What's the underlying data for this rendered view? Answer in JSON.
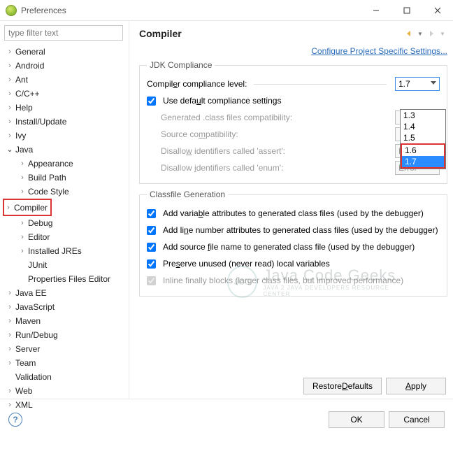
{
  "window": {
    "title": "Preferences"
  },
  "filter": {
    "placeholder": "type filter text"
  },
  "tree": {
    "items": [
      {
        "label": "General",
        "expandable": true
      },
      {
        "label": "Android",
        "expandable": true
      },
      {
        "label": "Ant",
        "expandable": true
      },
      {
        "label": "C/C++",
        "expandable": true
      },
      {
        "label": "Help",
        "expandable": true
      },
      {
        "label": "Install/Update",
        "expandable": true
      },
      {
        "label": "Ivy",
        "expandable": true
      },
      {
        "label": "Java",
        "expandable": true,
        "expanded": true,
        "children": [
          {
            "label": "Appearance",
            "expandable": true
          },
          {
            "label": "Build Path",
            "expandable": true
          },
          {
            "label": "Code Style",
            "expandable": true
          },
          {
            "label": "Compiler",
            "expandable": true,
            "selected": true
          },
          {
            "label": "Debug",
            "expandable": true
          },
          {
            "label": "Editor",
            "expandable": true
          },
          {
            "label": "Installed JREs",
            "expandable": true
          },
          {
            "label": "JUnit",
            "expandable": false
          },
          {
            "label": "Properties Files Editor",
            "expandable": false
          }
        ]
      },
      {
        "label": "Java EE",
        "expandable": true
      },
      {
        "label": "JavaScript",
        "expandable": true
      },
      {
        "label": "Maven",
        "expandable": true
      },
      {
        "label": "Run/Debug",
        "expandable": true
      },
      {
        "label": "Server",
        "expandable": true
      },
      {
        "label": "Team",
        "expandable": true
      },
      {
        "label": "Validation",
        "expandable": false
      },
      {
        "label": "Web",
        "expandable": true
      },
      {
        "label": "XML",
        "expandable": true
      }
    ]
  },
  "page": {
    "title": "Compiler",
    "configure_link": "Configure Project Specific Settings...",
    "jdk": {
      "legend": "JDK Compliance",
      "compliance_label": "Compiler compliance level:",
      "compliance_value": "1.7",
      "compliance_options": [
        "1.3",
        "1.4",
        "1.5",
        "1.6",
        "1.7"
      ],
      "use_default_label": "Use default compliance settings",
      "use_default_checked": true,
      "generated_label": "Generated .class files compatibility:",
      "generated_value": "",
      "source_label": "Source compatibility:",
      "source_value": "",
      "assert_label": "Disallow identifiers called 'assert':",
      "assert_value": "Error",
      "enum_label": "Disallow identifiers called 'enum':",
      "enum_value": "Error"
    },
    "classfile": {
      "legend": "Classfile Generation",
      "add_var_label": "Add variable attributes to generated class files (used by the debugger)",
      "add_var_checked": true,
      "add_line_label": "Add line number attributes to generated class files (used by the debugger)",
      "add_line_checked": true,
      "add_source_label": "Add source file name to generated class file (used by the debugger)",
      "add_source_checked": true,
      "preserve_label": "Preserve unused (never read) local variables",
      "preserve_checked": true,
      "inline_label": "Inline finally blocks (larger class files, but improved performance)",
      "inline_checked": true,
      "inline_enabled": false
    },
    "buttons": {
      "restore": "Restore Defaults",
      "apply": "Apply",
      "ok": "OK",
      "cancel": "Cancel"
    }
  },
  "watermark": {
    "main": "Java Code Geeks",
    "sub": "JAVA 2 JAVA DEVELOPERS RESOURCE CENTER",
    "badge": "JCG"
  }
}
